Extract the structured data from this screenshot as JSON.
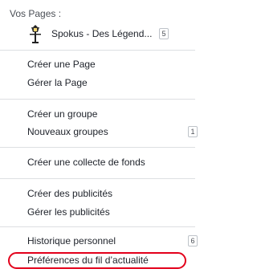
{
  "menu": {
    "pages_heading": "Vos Pages :",
    "page": {
      "name": "Spokus - Des Légend...",
      "count": "5"
    },
    "groups": [
      {
        "items": [
          {
            "label": "Créer une Page"
          },
          {
            "label": "Gérer la Page"
          }
        ]
      },
      {
        "items": [
          {
            "label": "Créer un groupe"
          },
          {
            "label": "Nouveaux groupes",
            "badge": "1"
          }
        ]
      },
      {
        "items": [
          {
            "label": "Créer une collecte de fonds"
          }
        ]
      },
      {
        "items": [
          {
            "label": "Créer des publicités"
          },
          {
            "label": "Gérer les publicités"
          }
        ]
      },
      {
        "items": [
          {
            "label": "Historique personnel",
            "badge": "6"
          },
          {
            "label": "Préférences du fil d’actualité"
          }
        ]
      }
    ],
    "highlight_color": "#e3001b"
  }
}
